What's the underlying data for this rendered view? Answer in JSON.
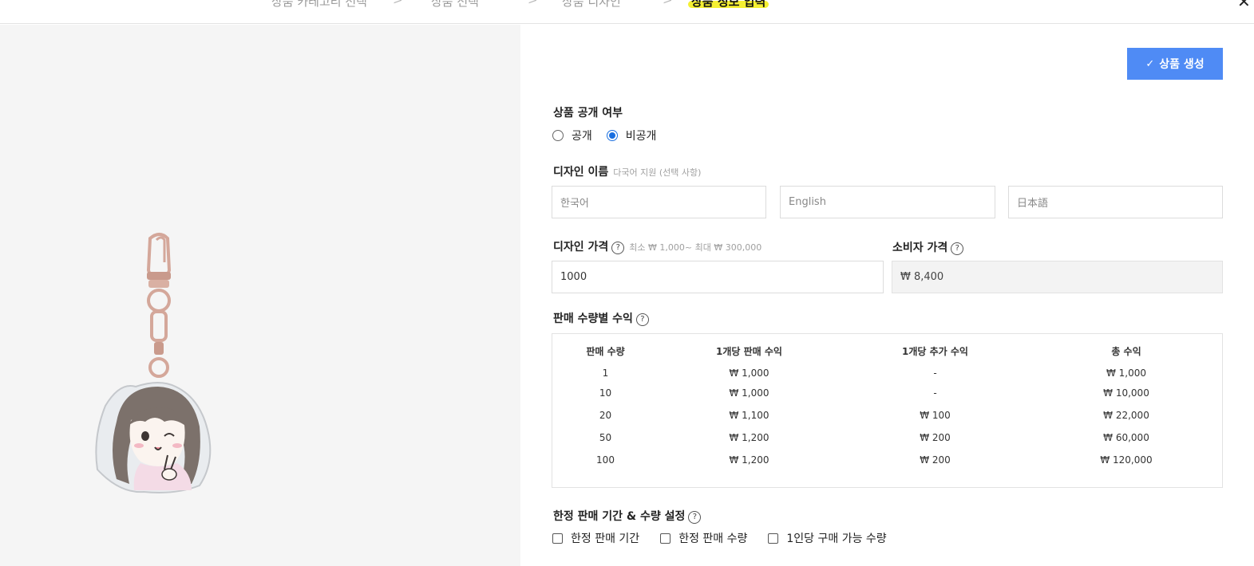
{
  "breadcrumb": {
    "steps": [
      "상품 카테고리 선택",
      "상품 선택",
      "상품 디자인",
      "상품 정보 입력"
    ],
    "separator": ">"
  },
  "close_label": "✕",
  "create_button": {
    "icon": "check-icon",
    "label": "상품 생성"
  },
  "visibility": {
    "title": "상품 공개 여부",
    "options": [
      "공개",
      "비공개"
    ],
    "selected": "비공개"
  },
  "design_name": {
    "title": "디자인 이름",
    "hint": "다국어 지원 (선택 사항)",
    "placeholders": [
      "한국어",
      "English",
      "日本語"
    ]
  },
  "design_price": {
    "title": "디자인 가격",
    "hint": "최소 ₩ 1,000~ 최대 ₩ 300,000",
    "value": "1000"
  },
  "consumer_price": {
    "title": "소비자 가격",
    "value": "₩ 8,400"
  },
  "profit_table": {
    "title": "판매 수량별 수익",
    "headers": [
      "판매 수량",
      "1개당 판매 수익",
      "1개당 추가 수익",
      "총 수익"
    ],
    "rows": [
      [
        "1",
        "₩ 1,000",
        "-",
        "₩ 1,000"
      ],
      [
        "10",
        "₩ 1,000",
        "-",
        "₩ 10,000"
      ],
      [
        "20",
        "₩ 1,100",
        "₩ 100",
        "₩ 22,000"
      ],
      [
        "50",
        "₩ 1,200",
        "₩ 200",
        "₩ 60,000"
      ],
      [
        "100",
        "₩ 1,200",
        "₩ 200",
        "₩ 120,000"
      ]
    ]
  },
  "limited": {
    "title": "한정 판매 기간 & 수량 설정",
    "options": [
      "한정 판매 기간",
      "한정 판매 수량",
      "1인당 구매 가능 수량"
    ]
  },
  "help_glyph": "?",
  "colors": {
    "accent": "#4f8bf5",
    "highlight": "#f5f033",
    "preview_bg": "#f5f5f5"
  }
}
